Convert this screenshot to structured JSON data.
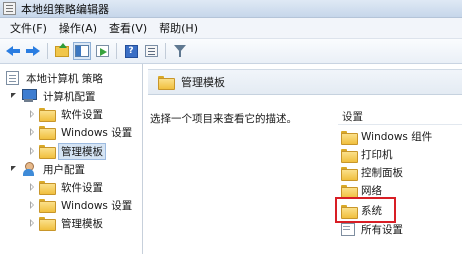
{
  "window": {
    "title": "本地组策略编辑器"
  },
  "menubar": {
    "items": [
      {
        "label": "文件(F)"
      },
      {
        "label": "操作(A)"
      },
      {
        "label": "查看(V)"
      },
      {
        "label": "帮助(H)"
      }
    ]
  },
  "toolbar": {
    "buttons": [
      {
        "icon": "arrow-left-icon"
      },
      {
        "icon": "arrow-right-icon"
      },
      {
        "icon": "up-folder-icon"
      },
      {
        "icon": "console-tree-icon"
      },
      {
        "icon": "export-icon"
      },
      {
        "icon": "help-icon",
        "glyph": "?"
      },
      {
        "icon": "properties-icon"
      },
      {
        "icon": "filter-icon"
      }
    ]
  },
  "tree": {
    "root": "本地计算机 策略",
    "computer_config": "计算机配置",
    "user_config": "用户配置",
    "software_settings": "软件设置",
    "windows_settings": "Windows 设置",
    "admin_templates": "管理模板",
    "selected": "管理模板"
  },
  "main": {
    "header_title": "管理模板",
    "description": "选择一个项目来查看它的描述。",
    "column_header": "设置",
    "items": [
      {
        "label": "Windows 组件",
        "icon": "folder-icon"
      },
      {
        "label": "打印机",
        "icon": "folder-icon"
      },
      {
        "label": "控制面板",
        "icon": "folder-icon"
      },
      {
        "label": "网络",
        "icon": "folder-icon"
      },
      {
        "label": "系统",
        "icon": "folder-icon",
        "highlighted": true
      },
      {
        "label": "所有设置",
        "icon": "all-settings-icon"
      }
    ],
    "highlight_color": "#d81e25"
  },
  "colors": {
    "selection": "#d5e4f4",
    "folder": "#f0bf3e",
    "toolbar_bg": "#eaf0f7"
  }
}
